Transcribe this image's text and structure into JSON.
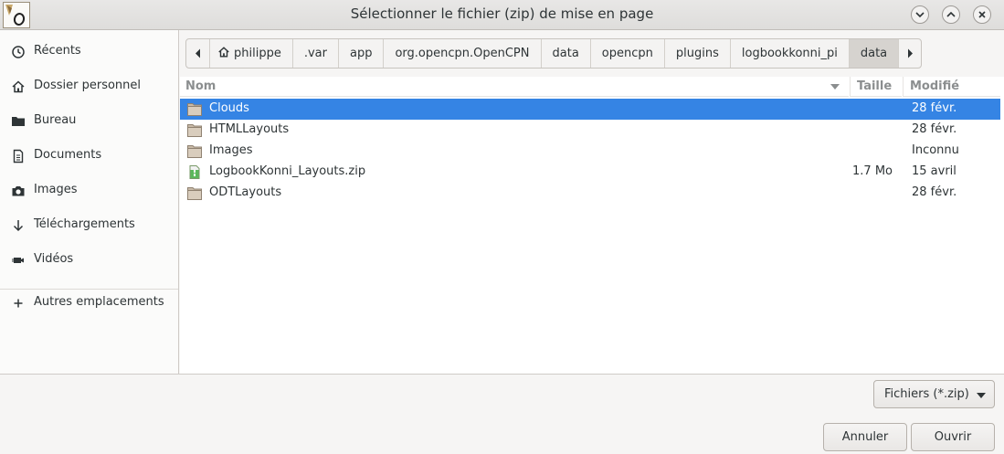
{
  "window": {
    "title": "Sélectionner le fichier (zip) de mise en page"
  },
  "sidebar": {
    "items": [
      {
        "label": "Récents",
        "icon": "clock-icon"
      },
      {
        "label": "Dossier personnel",
        "icon": "home-icon"
      },
      {
        "label": "Bureau",
        "icon": "folder-icon"
      },
      {
        "label": "Documents",
        "icon": "document-icon"
      },
      {
        "label": "Images",
        "icon": "camera-icon"
      },
      {
        "label": "Téléchargements",
        "icon": "download-icon"
      },
      {
        "label": "Vidéos",
        "icon": "video-icon"
      }
    ],
    "other_locations": "Autres emplacements"
  },
  "pathbar": {
    "crumbs": [
      "philippe",
      ".var",
      "app",
      "org.opencpn.OpenCPN",
      "data",
      "opencpn",
      "plugins",
      "logbookkonni_pi",
      "data"
    ]
  },
  "filelist": {
    "columns": {
      "name": "Nom",
      "size": "Taille",
      "modified": "Modifié"
    },
    "rows": [
      {
        "name": "Clouds",
        "size": "",
        "modified": "28 févr.",
        "type": "folder"
      },
      {
        "name": "HTMLLayouts",
        "size": "",
        "modified": "28 févr.",
        "type": "folder"
      },
      {
        "name": "Images",
        "size": "",
        "modified": "Inconnu",
        "type": "folder"
      },
      {
        "name": "LogbookKonni_Layouts.zip",
        "size": "1.7 Mo",
        "modified": "15 avril",
        "type": "zip"
      },
      {
        "name": "ODTLayouts",
        "size": "",
        "modified": "28 févr.",
        "type": "folder"
      }
    ]
  },
  "filter": {
    "label": "Fichiers (*.zip)"
  },
  "actions": {
    "cancel": "Annuler",
    "open": "Ouvrir"
  }
}
